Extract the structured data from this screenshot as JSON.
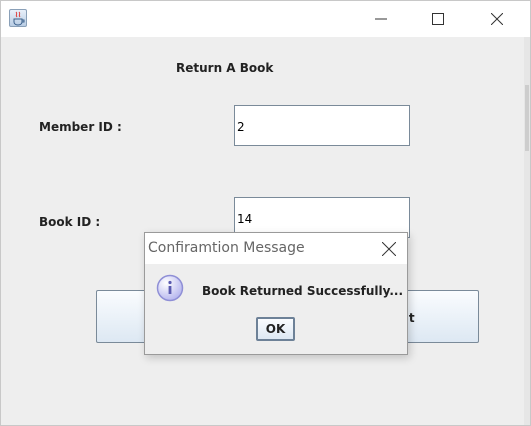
{
  "window": {
    "app_icon": "java-coffee-cup-icon",
    "controls": {
      "minimize_icon": "minimize-icon",
      "maximize_icon": "maximize-icon",
      "close_icon": "close-icon"
    }
  },
  "form": {
    "heading": "Return A Book",
    "member_id": {
      "label": "Member ID :",
      "value": "2"
    },
    "book_id": {
      "label": "Book ID :",
      "value": "14"
    },
    "buttons": {
      "return_label": "",
      "exit_label": "xit"
    }
  },
  "dialog": {
    "title": "Confiramtion Message",
    "icon": "info-icon",
    "message": "Book Returned Successfully...",
    "ok_label": "OK",
    "close_icon": "close-icon"
  },
  "colors": {
    "background": "#eeeeee",
    "titlebar": "#ffffff",
    "button_border": "#7a8a99",
    "info_icon": "#8f8fd6"
  }
}
